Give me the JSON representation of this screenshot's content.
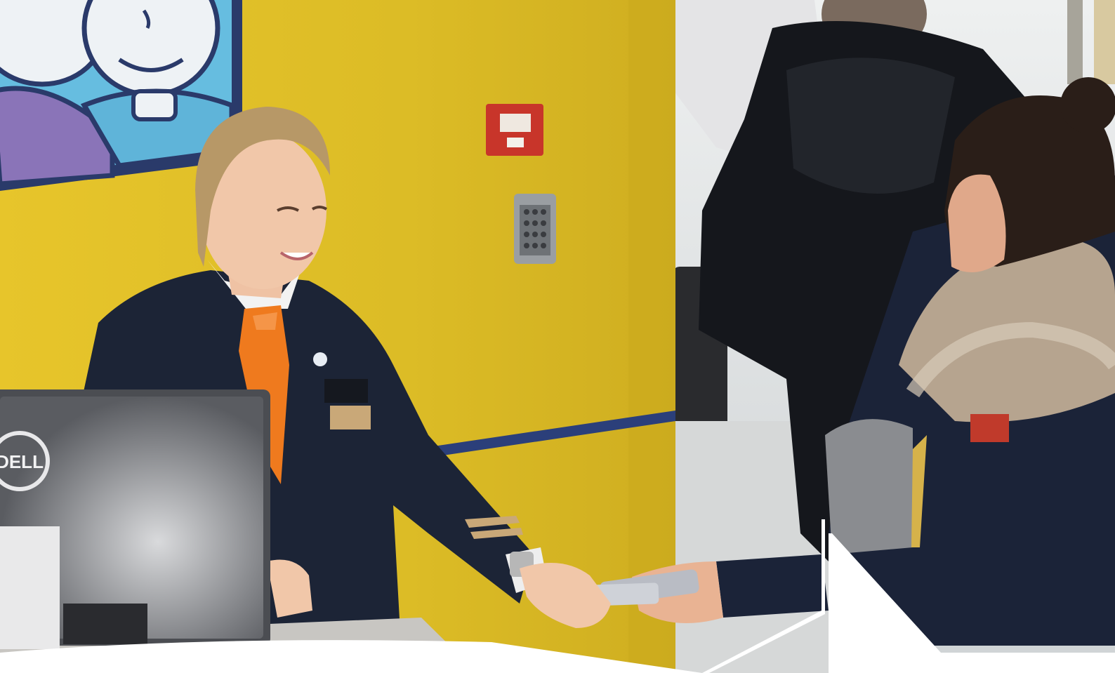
{
  "image": {
    "monitor_brand": "DELL"
  },
  "colors": {
    "wall_yellow": "#e3c22a",
    "wall_yellow_shadow": "#c9a91f",
    "navy_stripe": "#2b3f7a",
    "uniform_navy": "#1c2436",
    "scarf_orange": "#ef7a1e",
    "skin": "#f1c7a9",
    "hair_blonde": "#b79867",
    "jacket_black": "#15171c",
    "parka_navy": "#1b2338",
    "fur": "#b6a48f",
    "monitor_grey": "#4b4d52",
    "fire_alarm_red": "#c8352a",
    "keypad_grey": "#9a9ea2",
    "mural_blue": "#5fb4d9",
    "mural_purple": "#8a74b8",
    "mural_outline": "#2a3a6a",
    "frame_white": "#ffffff"
  }
}
